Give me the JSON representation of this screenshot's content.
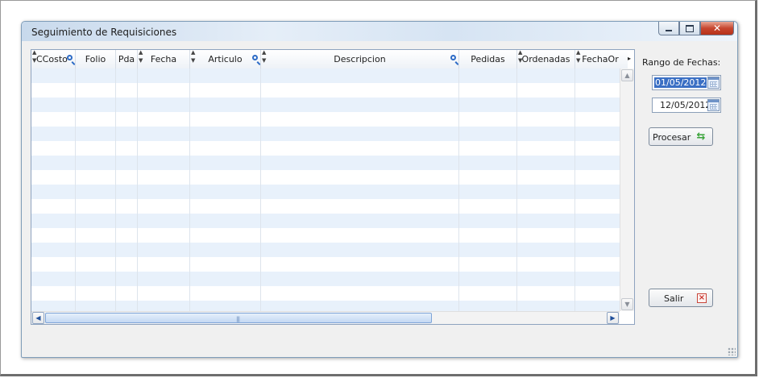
{
  "window": {
    "title": "Seguimiento de Requisiciones",
    "controls": {
      "minimize": "minimize",
      "maximize": "maximize",
      "close": "✕"
    }
  },
  "grid": {
    "columns": [
      {
        "label": "CCosto",
        "searchable": true,
        "sortable": true
      },
      {
        "label": "Folio",
        "searchable": false,
        "sortable": false
      },
      {
        "label": "Pda",
        "searchable": false,
        "sortable": false
      },
      {
        "label": "Fecha",
        "searchable": false,
        "sortable": true
      },
      {
        "label": "Articulo",
        "searchable": true,
        "sortable": true
      },
      {
        "label": "Descripcion",
        "searchable": true,
        "sortable": true
      },
      {
        "label": "Pedidas",
        "searchable": false,
        "sortable": false
      },
      {
        "label": "Ordenadas",
        "searchable": false,
        "sortable": true
      },
      {
        "label": "FechaOr",
        "searchable": false,
        "sortable": true
      }
    ],
    "rows": []
  },
  "filters": {
    "range_label": "Rango de Fechas:",
    "date_from": "01/05/2012",
    "date_to": "12/05/2012"
  },
  "actions": {
    "process_label": "Procesar",
    "exit_label": "Salir"
  },
  "icons": {
    "search": "search-icon",
    "calendar": "calendar-icon",
    "refresh": "refresh-icon",
    "close": "close-icon"
  },
  "colors": {
    "row_alt": "#e8f1fb",
    "selection": "#3a6fc4",
    "close_button": "#c7462f"
  }
}
